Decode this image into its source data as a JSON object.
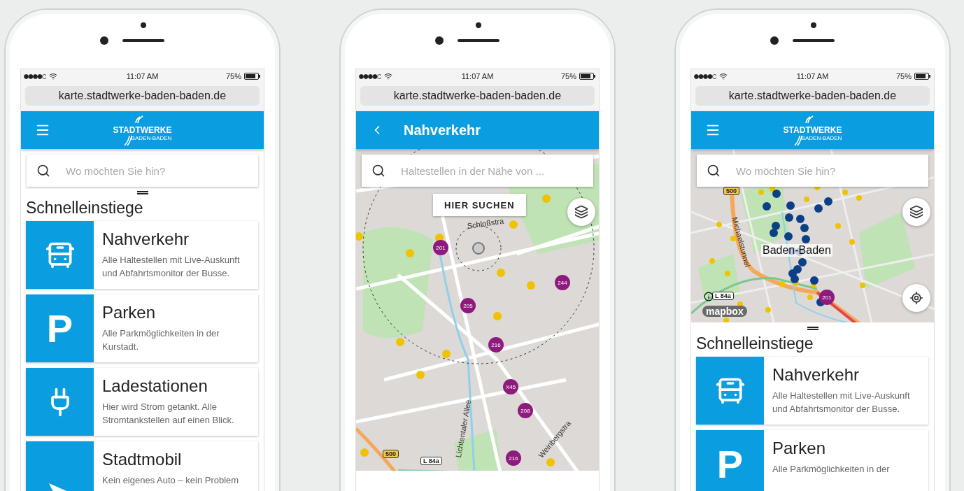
{
  "phones": [
    {
      "status": {
        "time": "11:07 AM",
        "battery": "75%"
      },
      "url": "karte.stadtwerke-baden-baden.de",
      "header": {
        "kind": "logo",
        "logo_text": "STADTWERKE",
        "logo_sub": "BADEN-BADEN"
      },
      "search": {
        "placeholder": "Wo möchten Sie hin?"
      },
      "quick": {
        "title": "Schnelleinstiege",
        "items": [
          {
            "kind": "bus",
            "title": "Nahverkehr",
            "description": "Alle Haltestellen mit Live-Auskunft und Abfahrtsmonitor der Busse."
          },
          {
            "kind": "glyph",
            "glyph": "P",
            "title": "Parken",
            "description": "Alle Parkmöglichkeiten in der Kurstadt."
          },
          {
            "kind": "plug",
            "title": "Ladestationen",
            "description": "Hier wird Strom getankt. Alle Stromtankstellen auf einen Blick."
          },
          {
            "kind": "arrow",
            "title": "Stadtmobil",
            "description": "Kein eigenes Auto – kein Problem"
          }
        ]
      }
    },
    {
      "status": {
        "time": "11:07 AM",
        "battery": "75%"
      },
      "url": "karte.stadtwerke-baden-baden.de",
      "header": {
        "kind": "back",
        "title": "Nahverkehr"
      },
      "search": {
        "placeholder": "Haltestellen in der Nähe von ..."
      },
      "map": {
        "kind": "radius",
        "action": "HIER SUCHEN",
        "labels": [
          "Schloßstra",
          "Lichtentaler Allee",
          "Weinbergstra",
          "500",
          "L 84a"
        ],
        "markers": [
          "201",
          "205",
          "244",
          "216",
          "X45",
          "208",
          "216"
        ]
      }
    },
    {
      "status": {
        "time": "11:07 AM",
        "battery": "75%"
      },
      "url": "karte.stadtwerke-baden-baden.de",
      "header": {
        "kind": "logo",
        "logo_text": "STADTWERKE",
        "logo_sub": "BADEN-BADEN"
      },
      "search": {
        "placeholder": "Wo möchten Sie hin?"
      },
      "map": {
        "kind": "overview",
        "attribution": "mapbox",
        "labels": [
          "Baden-Baden",
          "Michaelstunnel",
          "500",
          "L 84a"
        ],
        "markers": [
          "201"
        ]
      },
      "quick": {
        "title": "Schnelleinstiege",
        "items": [
          {
            "kind": "bus",
            "title": "Nahverkehr",
            "description": "Alle Haltestellen mit Live-Auskunft und Abfahrtsmonitor der Busse."
          },
          {
            "kind": "glyph",
            "glyph": "P",
            "title": "Parken",
            "description": "Alle Parkmöglichkeiten in der"
          }
        ]
      }
    }
  ]
}
